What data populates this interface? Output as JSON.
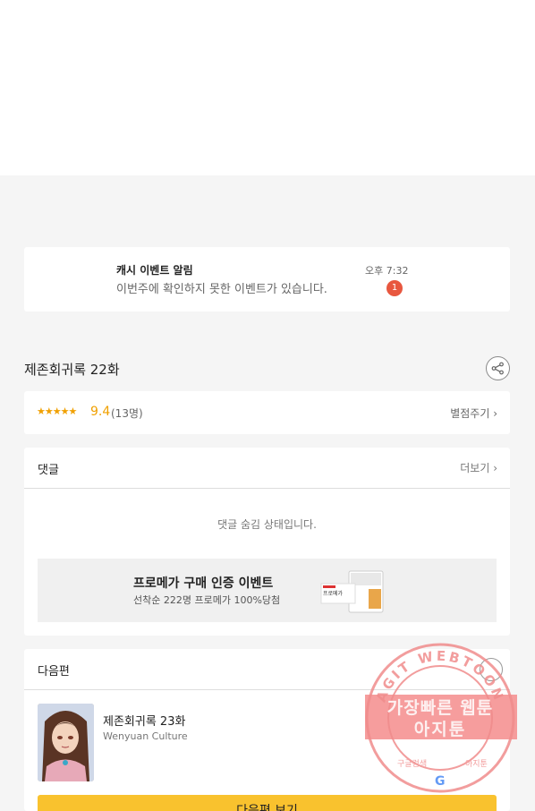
{
  "notification": {
    "title": "캐시 이벤트 알림",
    "message": "이번주에 확인하지 못한 이벤트가 있습니다.",
    "time": "오후 7:32",
    "badge": "1"
  },
  "episode": {
    "title": "제존회귀록 22화"
  },
  "rating": {
    "stars": "★★★★★",
    "score": "9.4",
    "count": "(13명)",
    "rate_link": "별점주기 ›"
  },
  "comments": {
    "label": "댓글",
    "more": "더보기 ›",
    "hidden_notice": "댓글 숨김 상태입니다.",
    "banner": {
      "title": "프로메가 구매 인증 이벤트",
      "subtitle": "선착순 222명 프로메가 100%당첨",
      "product_label": "프로메가"
    }
  },
  "next_episode": {
    "label": "다음편",
    "title": "제존회귀록 23화",
    "author": "Wenyuan Culture",
    "button": "다음편 보기"
  },
  "watermark": {
    "ring_text": "AGIT WEBTOON",
    "line1": "가장빠른 웹툰",
    "line2": "아지툰",
    "bottom_left": "구글검색",
    "bottom_right": "아지툰"
  },
  "colors": {
    "accent": "#f0a000",
    "badge": "#e8573f",
    "button": "#f9c22e",
    "watermark": "#f08c8c"
  }
}
